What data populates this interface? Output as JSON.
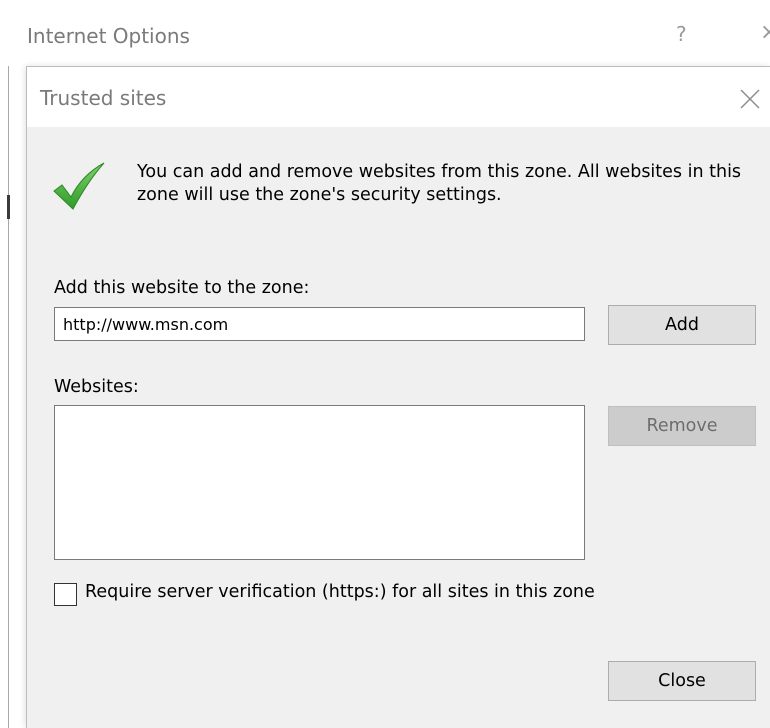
{
  "parent_window": {
    "title": "Internet Options",
    "help_glyph": "?",
    "close_glyph": "×"
  },
  "dialog": {
    "title": "Trusted sites",
    "close_icon": "close-icon",
    "intro_icon": "checkmark-icon",
    "intro_text": "You can add and remove websites from this zone. All websites in this zone will use the zone's security settings.",
    "add_label": "Add this website to the zone:",
    "url_value": "http://www.msn.com",
    "add_button": "Add",
    "websites_label": "Websites:",
    "websites": [],
    "remove_button": "Remove",
    "https_checkbox_checked": false,
    "https_label": "Require server verification (https:) for all sites in this zone",
    "close_button": "Close"
  },
  "colors": {
    "dialog_bg": "#f0f0f0",
    "titlebar_bg": "#ffffff",
    "title_text": "#7a7a7a",
    "check_green": "#4fae3e",
    "button_bg": "#e1e1e1",
    "button_disabled_bg": "#cccccc",
    "button_disabled_text": "#6d6d6d"
  }
}
